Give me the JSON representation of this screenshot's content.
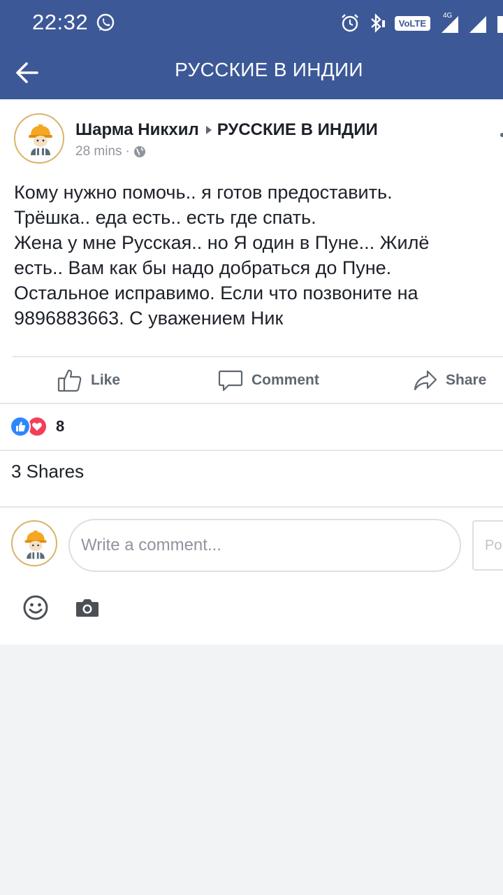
{
  "status_bar": {
    "time": "22:32",
    "volte": "VoLTE",
    "network": "4G"
  },
  "header": {
    "title": "РУССКИЕ В ИНДИИ"
  },
  "post": {
    "author": "Шарма Никхил",
    "group": "РУССКИЕ В ИНДИИ",
    "time": "28 mins",
    "separator": "·",
    "text": "Кому нужно помочь.. я готов предоставить.\nТрёшка.. еда есть.. есть где спать.\nЖена у мне Русская.. но Я один в Пуне... Жилё\nесть.. Вам как бы надо добраться до Пуне.\nОстальное исправимо. Если что позвоните на\n9896883663. С уважением Ник",
    "actions": {
      "like": "Like",
      "comment": "Comment",
      "share": "Share"
    },
    "reactions_count": "8",
    "shares": "3 Shares"
  },
  "comment_box": {
    "placeholder": "Write a comment...",
    "post_button": "Post"
  },
  "colors": {
    "brand_blue": "#3c5897",
    "like_blue": "#2d86ff",
    "love_red": "#f33e58",
    "text_gray": "#606770"
  }
}
